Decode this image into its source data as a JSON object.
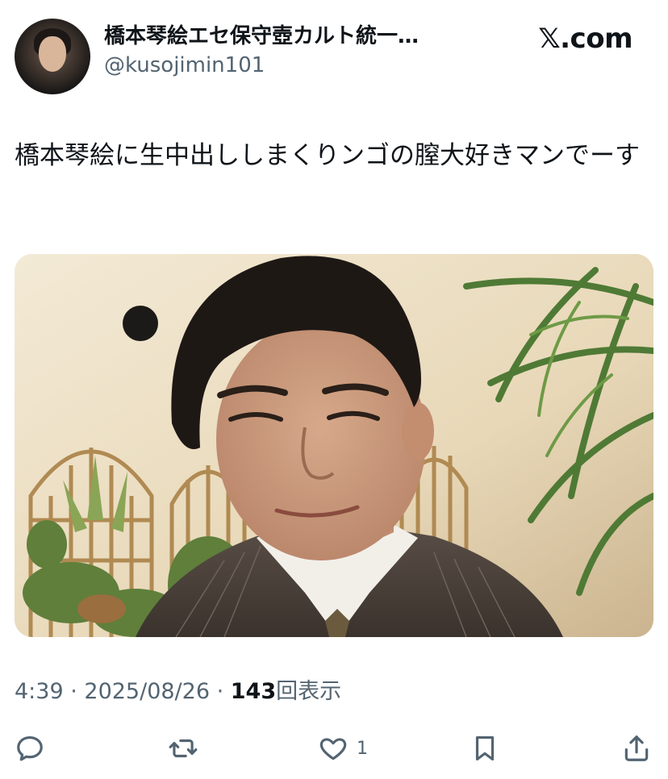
{
  "header": {
    "display_name": "橋本琴絵エセ保守壺カルト統一…",
    "handle": "@kusojimin101",
    "site_brand": "𝕏.com",
    "avatar_icon": "profile-avatar-photo"
  },
  "tweet": {
    "text": "橋本琴絵に生中出ししまくりンゴの膣大好きマンでーす",
    "image_description_icon": "photo-man-in-suit"
  },
  "meta": {
    "time": "4:39",
    "separator": " · ",
    "date": "2025/08/26",
    "views_count": "143",
    "views_label": "回表示"
  },
  "actions": {
    "reply_icon": "reply-icon",
    "retweet_icon": "retweet-icon",
    "like_icon": "heart-icon",
    "like_count": "1",
    "bookmark_icon": "bookmark-icon",
    "share_icon": "share-icon"
  },
  "colors": {
    "text_primary": "#0f1419",
    "text_secondary": "#536471",
    "background": "#ffffff"
  }
}
